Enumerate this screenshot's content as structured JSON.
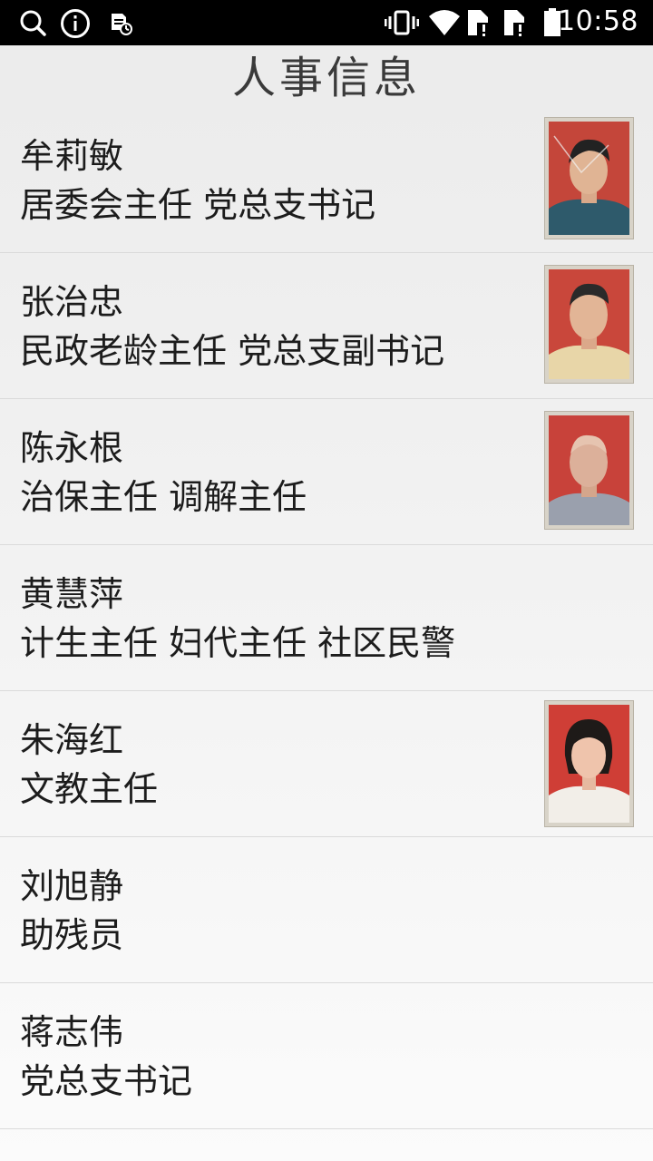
{
  "status_bar": {
    "time": "10:58",
    "icons": [
      "search-icon",
      "info-icon",
      "sd-card-icon",
      "vibrate-icon",
      "wifi-icon",
      "sim1-icon",
      "sim2-icon",
      "battery-icon"
    ]
  },
  "header": {
    "title": "人事信息"
  },
  "people": [
    {
      "name": "牟莉敏",
      "role": "居委会主任 党总支书记",
      "has_photo": true
    },
    {
      "name": "张治忠",
      "role": "民政老龄主任 党总支副书记",
      "has_photo": true
    },
    {
      "name": "陈永根",
      "role": "治保主任 调解主任",
      "has_photo": true
    },
    {
      "name": "黄慧萍",
      "role": "计生主任 妇代主任 社区民警",
      "has_photo": false
    },
    {
      "name": "朱海红",
      "role": "文教主任",
      "has_photo": true
    },
    {
      "name": "刘旭静",
      "role": "助残员",
      "has_photo": false
    },
    {
      "name": "蒋志伟",
      "role": "党总支书记",
      "has_photo": false
    }
  ],
  "colors": {
    "status_bar_bg": "#000000",
    "photo_bg_red": "#c0392b",
    "text": "#1c1c1c"
  }
}
